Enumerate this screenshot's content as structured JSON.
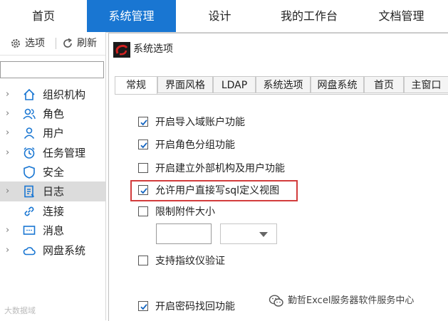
{
  "topnav": {
    "items": [
      {
        "label": "首页"
      },
      {
        "label": "系统管理"
      },
      {
        "label": "设计"
      },
      {
        "label": "我的工作台"
      },
      {
        "label": "文档管理"
      }
    ],
    "active_index": 1,
    "active_color": "#1976d2"
  },
  "toolbar": {
    "options_label": "选项",
    "refresh_label": "刷新"
  },
  "search": {
    "value": ""
  },
  "tree": {
    "items": [
      {
        "label": "组织机构",
        "icon": "home-icon"
      },
      {
        "label": "角色",
        "icon": "users-icon"
      },
      {
        "label": "用户",
        "icon": "user-icon"
      },
      {
        "label": "任务管理",
        "icon": "clock-icon"
      },
      {
        "label": "安全",
        "icon": "shield-icon"
      },
      {
        "label": "日志",
        "icon": "log-icon"
      },
      {
        "label": "连接",
        "icon": "link-icon"
      },
      {
        "label": "消息",
        "icon": "message-icon"
      },
      {
        "label": "网盘系统",
        "icon": "cloud-icon"
      }
    ],
    "selected": "日志"
  },
  "left_watermark": "大数据域",
  "dialog": {
    "title": "系统选项",
    "tabs": [
      "常规",
      "界面风格",
      "LDAP",
      "系统选项",
      "网盘系统",
      "首页",
      "主窗口"
    ],
    "active_tab": "常规",
    "options": [
      {
        "label": "开启导入域账户功能",
        "checked": true
      },
      {
        "label": "开启角色分组功能",
        "checked": true
      },
      {
        "label": "开启建立外部机构及用户功能",
        "checked": false
      },
      {
        "label": "允许用户直接写sql定义视图",
        "checked": true,
        "highlighted": true
      },
      {
        "label": "限制附件大小",
        "checked": false
      },
      {
        "label": "支持指纹仪验证",
        "checked": false
      },
      {
        "label": "开启密码找回功能",
        "checked": true
      }
    ],
    "attachment_size_value": "",
    "attachment_unit_value": ""
  },
  "watermark": {
    "text": "勤哲Excel服务器软件服务中心"
  },
  "colors": {
    "highlight": "#d23c3c",
    "selected_row": "#dcdcdc",
    "icon_blue": "#1976d2"
  }
}
